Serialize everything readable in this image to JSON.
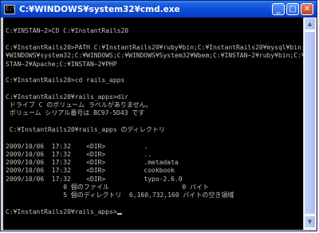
{
  "window": {
    "title": "C:¥WINDOWS¥system32¥cmd.exe",
    "icon_label": "C:\\",
    "controls": {
      "minimize": "_",
      "maximize": "□",
      "close": "✕"
    }
  },
  "console": {
    "lines": [
      "",
      "C:¥INSTAN~2>CD C:¥InstantRails20",
      "",
      "C:¥InstantRails20>PATH C:¥InstantRails20¥ruby¥bin;C:¥InstantRails20¥mysql¥bin;C:",
      "¥WINDOWS¥system32;C:¥WINDOWS;C:¥WINDOWS¥System32¥Wbem;C:¥INSTAN~2¥ruby¥bin;C:¥INI",
      "STAN~2¥Apache;C:¥INSTAN~2¥PHP",
      "",
      "C:¥InstantRails20>cd rails_apps",
      "",
      "C:¥InstantRails20¥rails_apps>dir",
      " ドライブ C のボリューム ラベルがありません。",
      " ボリューム シリアル番号は BC97-5D43 です",
      "",
      " C:¥InstantRails20¥rails_apps のディレクトリ",
      "",
      "2009/10/06  17:32    <DIR>          .",
      "2009/10/06  17:32    <DIR>          ..",
      "2009/10/06  17:32    <DIR>          .metadata",
      "2009/10/06  17:32    <DIR>          cookbook",
      "2009/10/06  17:32    <DIR>          typo-2.6.0",
      "               0 個のファイル                   0 バイト",
      "               5 個のディレクトリ  6,160,732,160 バイトの空き領域",
      "",
      "C:¥InstantRails20¥rails_apps>"
    ]
  },
  "scrollbar": {
    "up_arrow": "▲",
    "down_arrow": "▼"
  }
}
